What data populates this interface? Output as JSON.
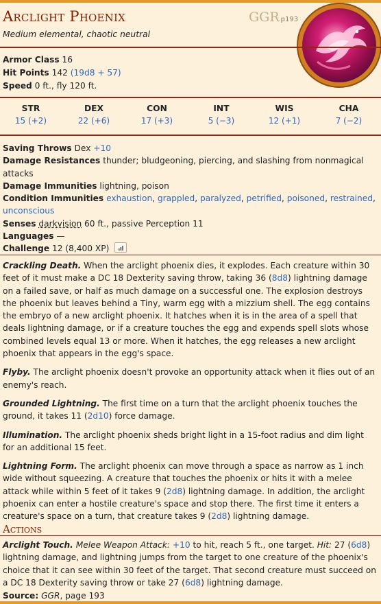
{
  "header": {
    "name": "Arclight Phoenix",
    "source_abbr": "GGR",
    "source_page": "p193",
    "subtitle": "Medium elemental, chaotic neutral"
  },
  "props": {
    "ac_label": "Armor Class",
    "ac_value": "16",
    "hp_label": "Hit Points",
    "hp_value": "142",
    "hp_formula": "(19d8 + 57)",
    "speed_label": "Speed",
    "speed_value": "0 ft., fly 120 ft."
  },
  "abilities": [
    {
      "label": "STR",
      "value": "15 (+2)"
    },
    {
      "label": "DEX",
      "value": "22 (+6)"
    },
    {
      "label": "CON",
      "value": "17 (+3)"
    },
    {
      "label": "INT",
      "value": "5 (−3)"
    },
    {
      "label": "WIS",
      "value": "12 (+1)"
    },
    {
      "label": "CHA",
      "value": "7 (−2)"
    }
  ],
  "details": {
    "saves_label": "Saving Throws",
    "saves_text": "Dex",
    "saves_bonus": "+10",
    "resist_label": "Damage Resistances",
    "resist_text": "thunder; bludgeoning, piercing, and slashing from nonmagical attacks",
    "immune_label": "Damage Immunities",
    "immune_text": "lightning, poison",
    "cond_label": "Condition Immunities",
    "conditions": [
      "exhaustion",
      "grappled",
      "paralyzed",
      "petrified",
      "poisoned",
      "restrained",
      "unconscious"
    ],
    "senses_label": "Senses",
    "senses_link": "darkvision",
    "senses_text": "60 ft., passive Perception 11",
    "lang_label": "Languages",
    "lang_text": "—",
    "cr_label": "Challenge",
    "cr_text": "12 (8,400 XP)"
  },
  "traits": [
    {
      "name": "Crackling Death.",
      "pre": "When the arclight phoenix dies, it explodes. Each creature within 30 feet of it must make a DC 18 Dexterity saving throw, taking 36 (",
      "dice": "8d8",
      "post": ") lightning damage on a failed save, or half as much damage on a successful one. The explosion destroys the phoenix but leaves behind a Tiny, warm egg with a mizzium shell. The egg contains the embryo of a new arclight phoenix. It hatches when it is in the area of a spell that deals lightning damage, or if a creature touches the egg and expends spell slots whose combined levels equal 13 or more. When it hatches, the egg releases a new arclight phoenix that appears in the egg's space."
    },
    {
      "name": "Flyby.",
      "pre": "The arclight phoenix doesn't provoke an opportunity attack when it flies out of an enemy's reach.",
      "dice": "",
      "post": ""
    },
    {
      "name": "Grounded Lightning.",
      "pre": "The first time on a turn that the arclight phoenix touches the ground, it takes 11 (",
      "dice": "2d10",
      "post": ") force damage."
    },
    {
      "name": "Illumination.",
      "pre": "The arclight phoenix sheds bright light in a 15-foot radius and dim light for an additional 15 feet.",
      "dice": "",
      "post": ""
    },
    {
      "name": "Lightning Form.",
      "pre": "The arclight phoenix can move through a space as narrow as 1 inch wide without squeezing. A creature that touches the phoenix or hits it with a melee attack while within 5 feet of it takes 9 (",
      "dice": "2d8",
      "post": ") lightning damage. In addition, the arclight phoenix can enter a hostile creature's space and stop there. The first time it enters a creature's space on a turn, that creature takes 9 (",
      "dice2": "2d8",
      "post2": ") lightning damage."
    }
  ],
  "actions": {
    "title": "Actions",
    "name": "Arclight Touch.",
    "attack_type": "Melee Weapon Attack:",
    "bonus": "+10",
    "reach": "to hit, reach 5 ft., one target.",
    "hit_label": "Hit:",
    "hit_pre": "27 (",
    "dice1": "6d8",
    "mid": ") lightning damage, and lightning jumps from the target to one creature of the phoenix's choice that it can see within 30 feet of the target. That second creature must succeed on a DC 18 Dexterity saving throw or take 27 (",
    "dice2": "6d8",
    "end": ") lightning damage."
  },
  "footer": {
    "label": "Source:",
    "book": "GGR",
    "page": ", page 193"
  },
  "colors": {
    "accent": "#822000",
    "link": "#2a67c0",
    "border": "#e69a28",
    "background": "#fdf1dc"
  }
}
